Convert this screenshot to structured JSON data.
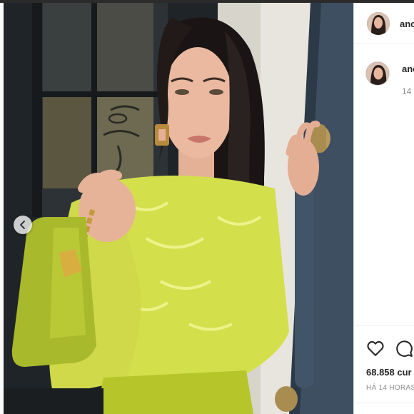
{
  "post": {
    "username": "anc",
    "comment_time": "14",
    "likes_text": "68.858 cur",
    "date_text": "HÁ 14 HORAS"
  },
  "colors": {
    "accent_blouse": "#d6e04a",
    "bag": "#a8b82a",
    "door": "#3f5266",
    "background_wall": "#e9e6df"
  },
  "icons": {
    "prev": "chevron-left-icon",
    "like": "heart-icon",
    "comment": "comment-icon"
  }
}
